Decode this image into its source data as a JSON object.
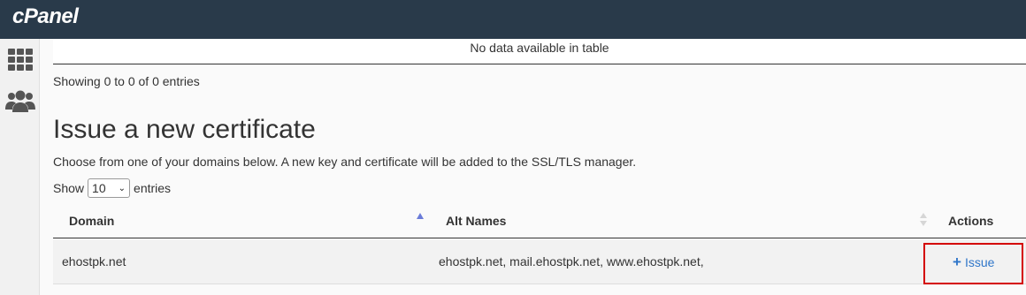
{
  "header": {
    "logo_text": "cPanel",
    "background": "#293a4a"
  },
  "sidebar": {
    "items": [
      {
        "icon": "grid-icon"
      },
      {
        "icon": "users-icon"
      }
    ]
  },
  "previous_table": {
    "empty_message": "No data available in table",
    "info": "Showing 0 to 0 of 0 entries"
  },
  "issue_section": {
    "title": "Issue a new certificate",
    "description": "Choose from one of your domains below. A new key and certificate will be added to the SSL/TLS manager.",
    "show_label": "Show",
    "page_size": "10",
    "entries_label": "entries",
    "columns": [
      "Domain",
      "Alt Names",
      "Actions"
    ],
    "rows": [
      {
        "domain": "ehostpk.net",
        "alt_names": "ehostpk.net, mail.ehostpk.net, www.ehostpk.net,",
        "action": "Issue"
      }
    ]
  },
  "colors": {
    "link": "#2f76c9",
    "highlight_border": "#d40000"
  }
}
